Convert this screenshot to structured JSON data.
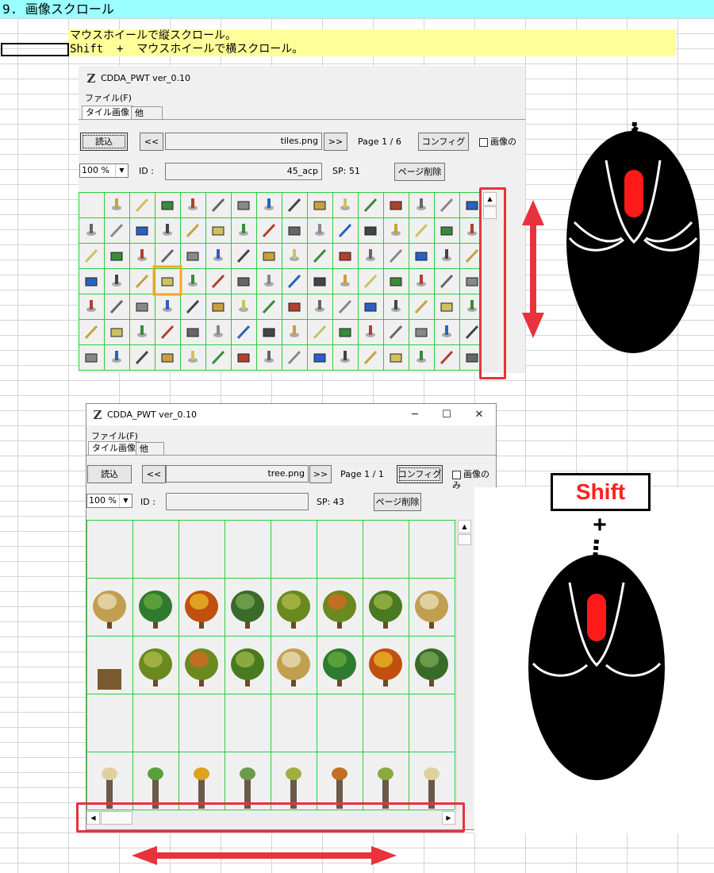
{
  "sheet": {
    "heading": "9. 画像スクロール",
    "note_vertical": "マウスホイールで縦スクロール。",
    "note_horizontal": "Shift  +  マウスホイールで横スクロール。"
  },
  "window1": {
    "title": "CDDA_PWT  ver_0.10",
    "menu_file": "ファイル(F)",
    "tab_tile": "タイル画像",
    "tab_other": "他",
    "load_button": "読込",
    "prev_button": "<<",
    "next_button": ">>",
    "file_name": "tiles.png",
    "page_label": "Page  1 / 6",
    "config_button": "コンフィグ",
    "image_only_checkbox": "画像の",
    "zoom_value": "100 %",
    "id_label": "ID :",
    "id_value": "45_acp",
    "sp_label": "SP:  51",
    "delete_page_button": "ページ削除"
  },
  "window2": {
    "title": "CDDA_PWT  ver_0.10",
    "menu_file": "ファイル(F)",
    "tab_tile": "タイル画像",
    "tab_other": "他",
    "load_button": "読込",
    "prev_button": "<<",
    "next_button": ">>",
    "file_name": "tree.png",
    "page_label": "Page  1 / 1",
    "config_button": "コンフィグ",
    "image_only_checkbox": "画像のみ",
    "zoom_value": "100 %",
    "id_label": "ID :",
    "id_value": "",
    "sp_label": "SP:  43",
    "delete_page_button": "ページ削除",
    "minimize_icon": "─",
    "maximize_icon": "☐",
    "close_icon": "✕"
  },
  "overlay": {
    "shift_key_label": "Shift",
    "plus_sign": "+",
    "highlight_color": "#e8323c",
    "mouse_button_color": "#ff1a1a",
    "selected_tile_color": "#f5a623",
    "grid_line_color": "#2ecc40"
  }
}
